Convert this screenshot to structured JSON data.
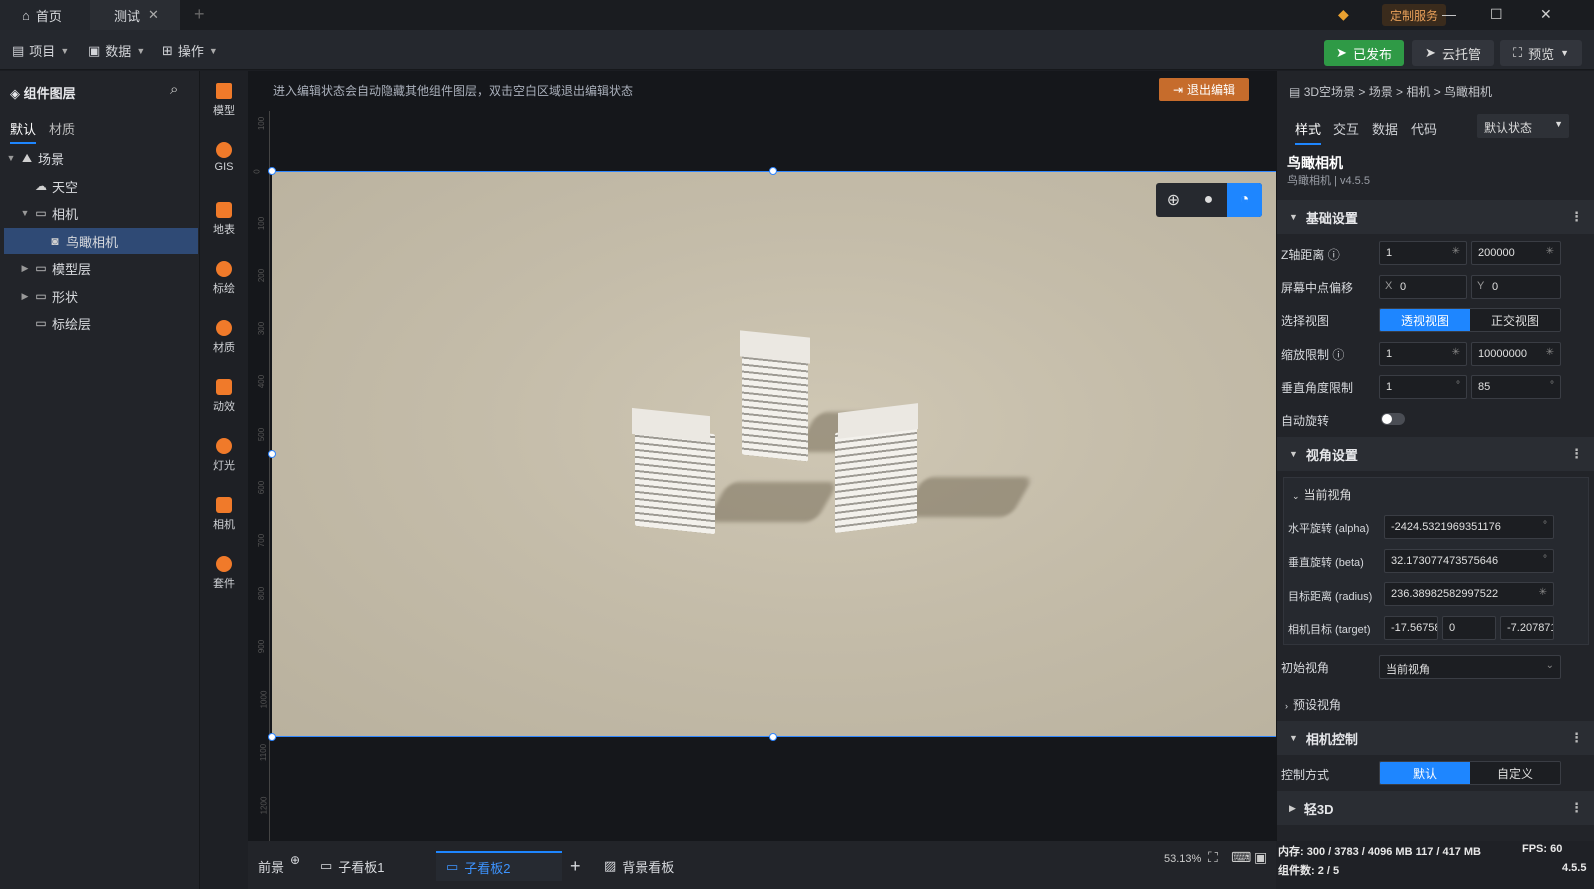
{
  "titlebar": {
    "home_tab": "首页",
    "active_tab": "测试",
    "custom_service": "定制服务"
  },
  "toolbar": {
    "menu_project": "项目",
    "menu_data": "数据",
    "menu_operate": "操作",
    "publish": "已发布",
    "cloud": "云托管",
    "preview": "预览"
  },
  "left": {
    "title": "组件图层",
    "tab_default": "默认",
    "tab_material": "材质",
    "tree": [
      {
        "label": "场景"
      },
      {
        "label": "天空"
      },
      {
        "label": "相机"
      },
      {
        "label": "鸟瞰相机"
      },
      {
        "label": "模型层"
      },
      {
        "label": "形状"
      },
      {
        "label": "标绘层"
      }
    ]
  },
  "rail": [
    {
      "label": "模型"
    },
    {
      "label": "GIS"
    },
    {
      "label": "地表"
    },
    {
      "label": "标绘"
    },
    {
      "label": "材质"
    },
    {
      "label": "动效"
    },
    {
      "label": "灯光"
    },
    {
      "label": "相机"
    },
    {
      "label": "套件"
    }
  ],
  "canvas": {
    "notice": "进入编辑状态会自动隐藏其他组件图层，双击空白区域退出编辑状态",
    "exit_edit": "退出编辑",
    "ruler_marks": [
      "100",
      "0",
      "100",
      "200",
      "300",
      "400",
      "500",
      "600",
      "700",
      "800",
      "900",
      "1000",
      "1100",
      "1200"
    ]
  },
  "bottom": {
    "foreground": "前景",
    "board1": "子看板1",
    "board2": "子看板2",
    "background": "背景看板",
    "zoom": "53.13%"
  },
  "right": {
    "breadcrumb": "3D空场景 > 场景 > 相机 > 鸟瞰相机",
    "tab_style": "样式",
    "tab_interact": "交互",
    "tab_data": "数据",
    "tab_code": "代码",
    "state_select": "默认状态",
    "component_title": "鸟瞰相机",
    "component_sub": "鸟瞰相机 | v4.5.5",
    "section_basic": "基础设置",
    "z_distance_label": "Z轴距离",
    "z_min": "1",
    "z_max": "200000",
    "screen_offset_label": "屏幕中点偏移",
    "offset_x_prefix": "X",
    "offset_x": "0",
    "offset_y_prefix": "Y",
    "offset_y": "0",
    "view_select_label": "选择视图",
    "view_perspective": "透视视图",
    "view_ortho": "正交视图",
    "zoom_limit_label": "缩放限制",
    "zoom_min": "1",
    "zoom_max": "10000000",
    "vert_angle_label": "垂直角度限制",
    "vert_min": "1",
    "vert_max": "85",
    "degree_unit": "°",
    "auto_rotate_label": "自动旋转",
    "section_view": "视角设置",
    "current_view": "当前视角",
    "alpha_label": "水平旋转 (alpha)",
    "alpha_value": "-2424.5321969351176",
    "beta_label": "垂直旋转 (beta)",
    "beta_value": "32.173077473575646",
    "radius_label": "目标距离 (radius)",
    "radius_value": "236.38982582997522",
    "target_label": "相机目标 (target)",
    "target_x": "-17.56758",
    "target_y": "0",
    "target_z": "-7.207871",
    "init_view_label": "初始视角",
    "init_view_value": "当前视角",
    "preset_view": "预设视角",
    "section_camera": "相机控制",
    "control_label": "控制方式",
    "control_default": "默认",
    "control_custom": "自定义",
    "section_light": "轻3D"
  },
  "status": {
    "memory": "内存:  300 / 3783 / 4096 MB  117 / 417 MB",
    "fps": "FPS:  60",
    "components": "组件数: 2 / 5",
    "version": "4.5.5"
  }
}
